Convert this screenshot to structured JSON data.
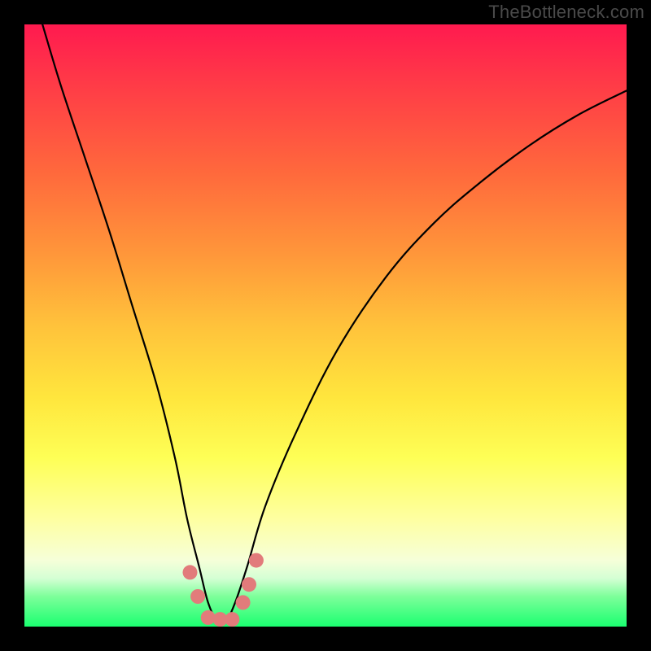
{
  "watermark": "TheBottleneck.com",
  "chart_data": {
    "type": "line",
    "title": "",
    "xlabel": "",
    "ylabel": "",
    "xlim": [
      0,
      100
    ],
    "ylim": [
      0,
      100
    ],
    "grid": false,
    "legend": false,
    "series": [
      {
        "name": "bottleneck-curve",
        "x": [
          3,
          6,
          10,
          14,
          18,
          22,
          25,
          27,
          29,
          30.5,
          32,
          33.5,
          35,
          37,
          40,
          45,
          52,
          60,
          68,
          76,
          84,
          92,
          100
        ],
        "values": [
          100,
          90,
          78,
          66,
          53,
          40,
          28,
          18,
          10,
          4,
          1,
          1,
          4,
          10,
          20,
          32,
          46,
          58,
          67,
          74,
          80,
          85,
          89
        ]
      }
    ],
    "markers": {
      "name": "highlighted-points",
      "color": "#e27b7b",
      "radius": 9,
      "points": [
        {
          "x": 27.5,
          "y": 9
        },
        {
          "x": 28.8,
          "y": 5
        },
        {
          "x": 30.5,
          "y": 1.5
        },
        {
          "x": 32.5,
          "y": 1.2
        },
        {
          "x": 34.5,
          "y": 1.2
        },
        {
          "x": 36.3,
          "y": 4
        },
        {
          "x": 37.3,
          "y": 7
        },
        {
          "x": 38.5,
          "y": 11
        }
      ]
    },
    "background_gradient": {
      "direction": "vertical",
      "stops": [
        {
          "pos": 0.0,
          "color": "#ff1a4f"
        },
        {
          "pos": 0.25,
          "color": "#ff6a3c"
        },
        {
          "pos": 0.5,
          "color": "#ffc23b"
        },
        {
          "pos": 0.72,
          "color": "#feff56"
        },
        {
          "pos": 0.89,
          "color": "#f6ffd9"
        },
        {
          "pos": 1.0,
          "color": "#1aff70"
        }
      ]
    }
  }
}
